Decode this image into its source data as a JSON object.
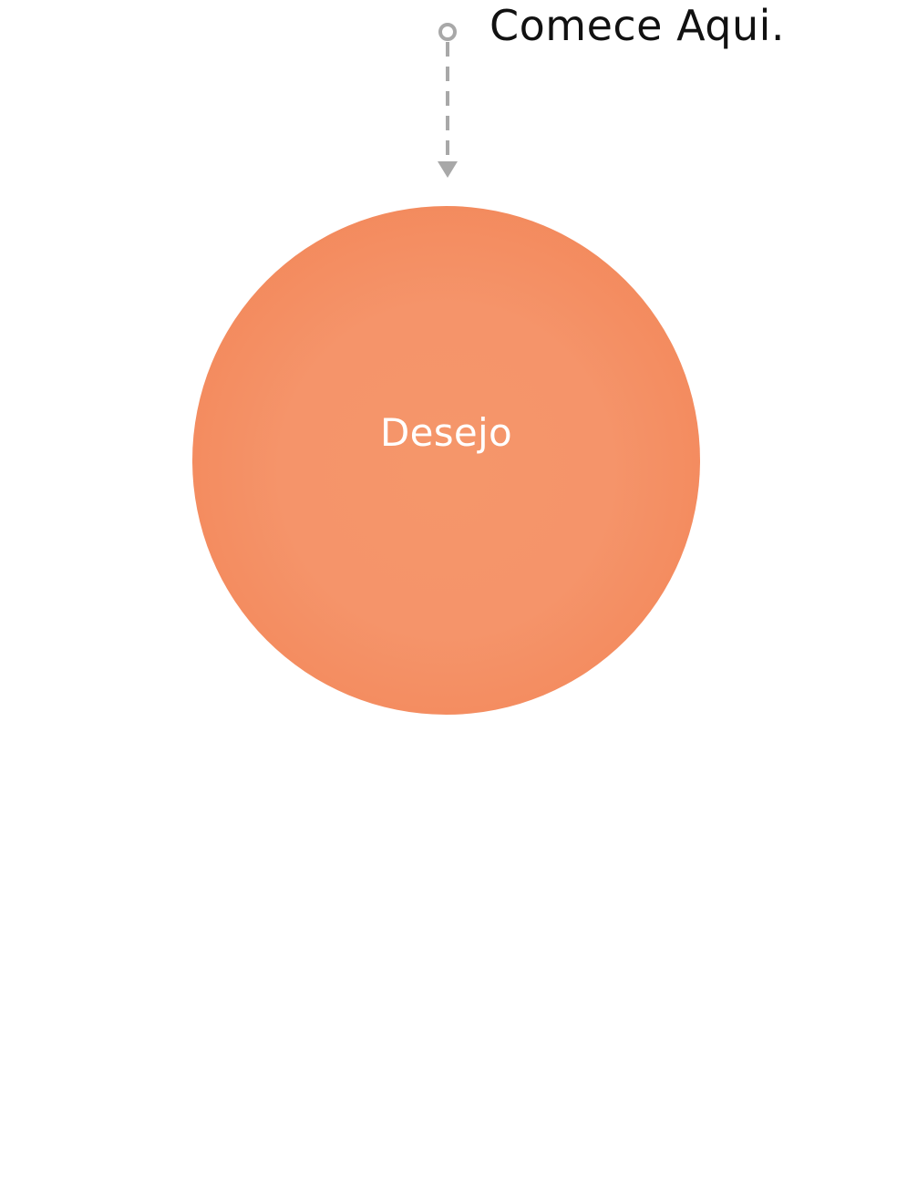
{
  "start": {
    "label": "Comece Aqui."
  },
  "node": {
    "label": "Desejo"
  },
  "colors": {
    "node_fill": "#f5946a",
    "node_edge": "#f27b4d",
    "connector": "#a8a8a8",
    "start_text": "#111111",
    "node_text": "#ffffff"
  }
}
